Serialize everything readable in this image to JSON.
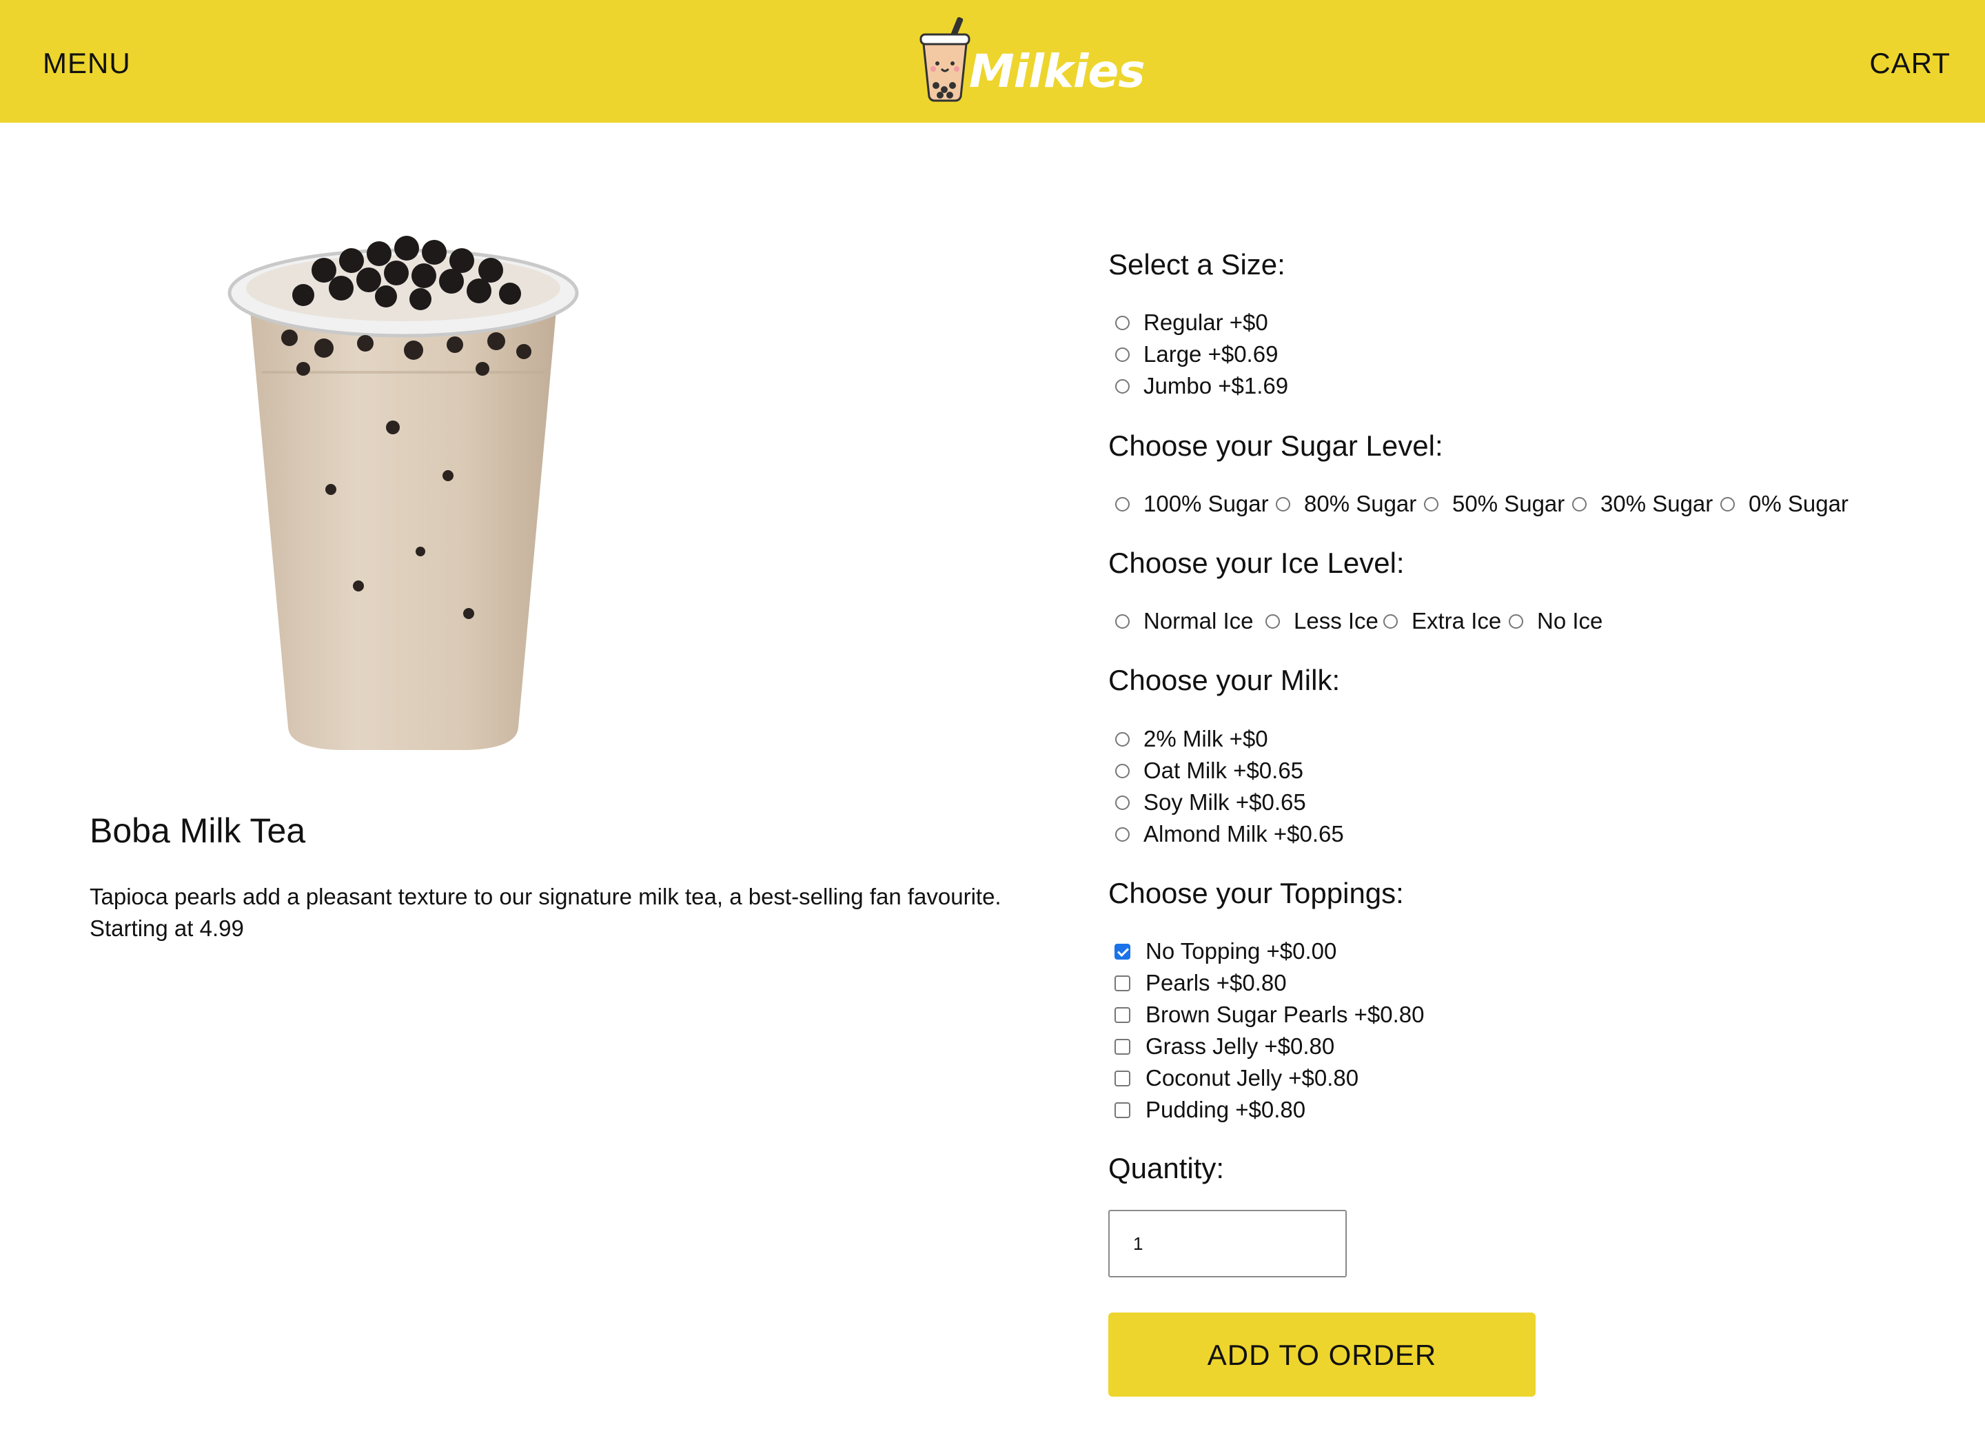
{
  "nav": {
    "menu_label": "MENU",
    "cart_label": "CART",
    "logo_text": "Milkies"
  },
  "colors": {
    "brand_yellow": "#edd52d",
    "text": "#111111",
    "checkbox_checked": "#1a73e8"
  },
  "product": {
    "title": "Boba Milk Tea",
    "description": "Tapioca pearls add a pleasant texture to our signature milk tea, a best-selling fan favourite.",
    "starting_price": "Starting at 4.99"
  },
  "size": {
    "heading": "Select a Size:",
    "options": [
      "Regular +$0",
      "Large +$0.69",
      "Jumbo +$1.69"
    ]
  },
  "sugar": {
    "heading": "Choose your Sugar Level:",
    "options": [
      "100% Sugar",
      "80% Sugar",
      "50% Sugar",
      "30% Sugar",
      "0% Sugar"
    ]
  },
  "ice": {
    "heading": "Choose your Ice Level:",
    "options": [
      "Normal Ice",
      "Less Ice",
      "Extra Ice",
      "No Ice"
    ]
  },
  "milk": {
    "heading": "Choose your Milk:",
    "options": [
      "2% Milk +$0",
      "Oat Milk +$0.65",
      "Soy Milk +$0.65",
      "Almond Milk +$0.65"
    ]
  },
  "toppings": {
    "heading": "Choose your Toppings:",
    "options": [
      {
        "label": "No Topping +$0.00",
        "checked": true
      },
      {
        "label": "Pearls +$0.80",
        "checked": false
      },
      {
        "label": "Brown Sugar Pearls +$0.80",
        "checked": false
      },
      {
        "label": "Grass Jelly +$0.80",
        "checked": false
      },
      {
        "label": "Coconut Jelly +$0.80",
        "checked": false
      },
      {
        "label": "Pudding +$0.80",
        "checked": false
      }
    ]
  },
  "quantity": {
    "heading": "Quantity:",
    "value": "1"
  },
  "add_button_label": "ADD TO ORDER"
}
